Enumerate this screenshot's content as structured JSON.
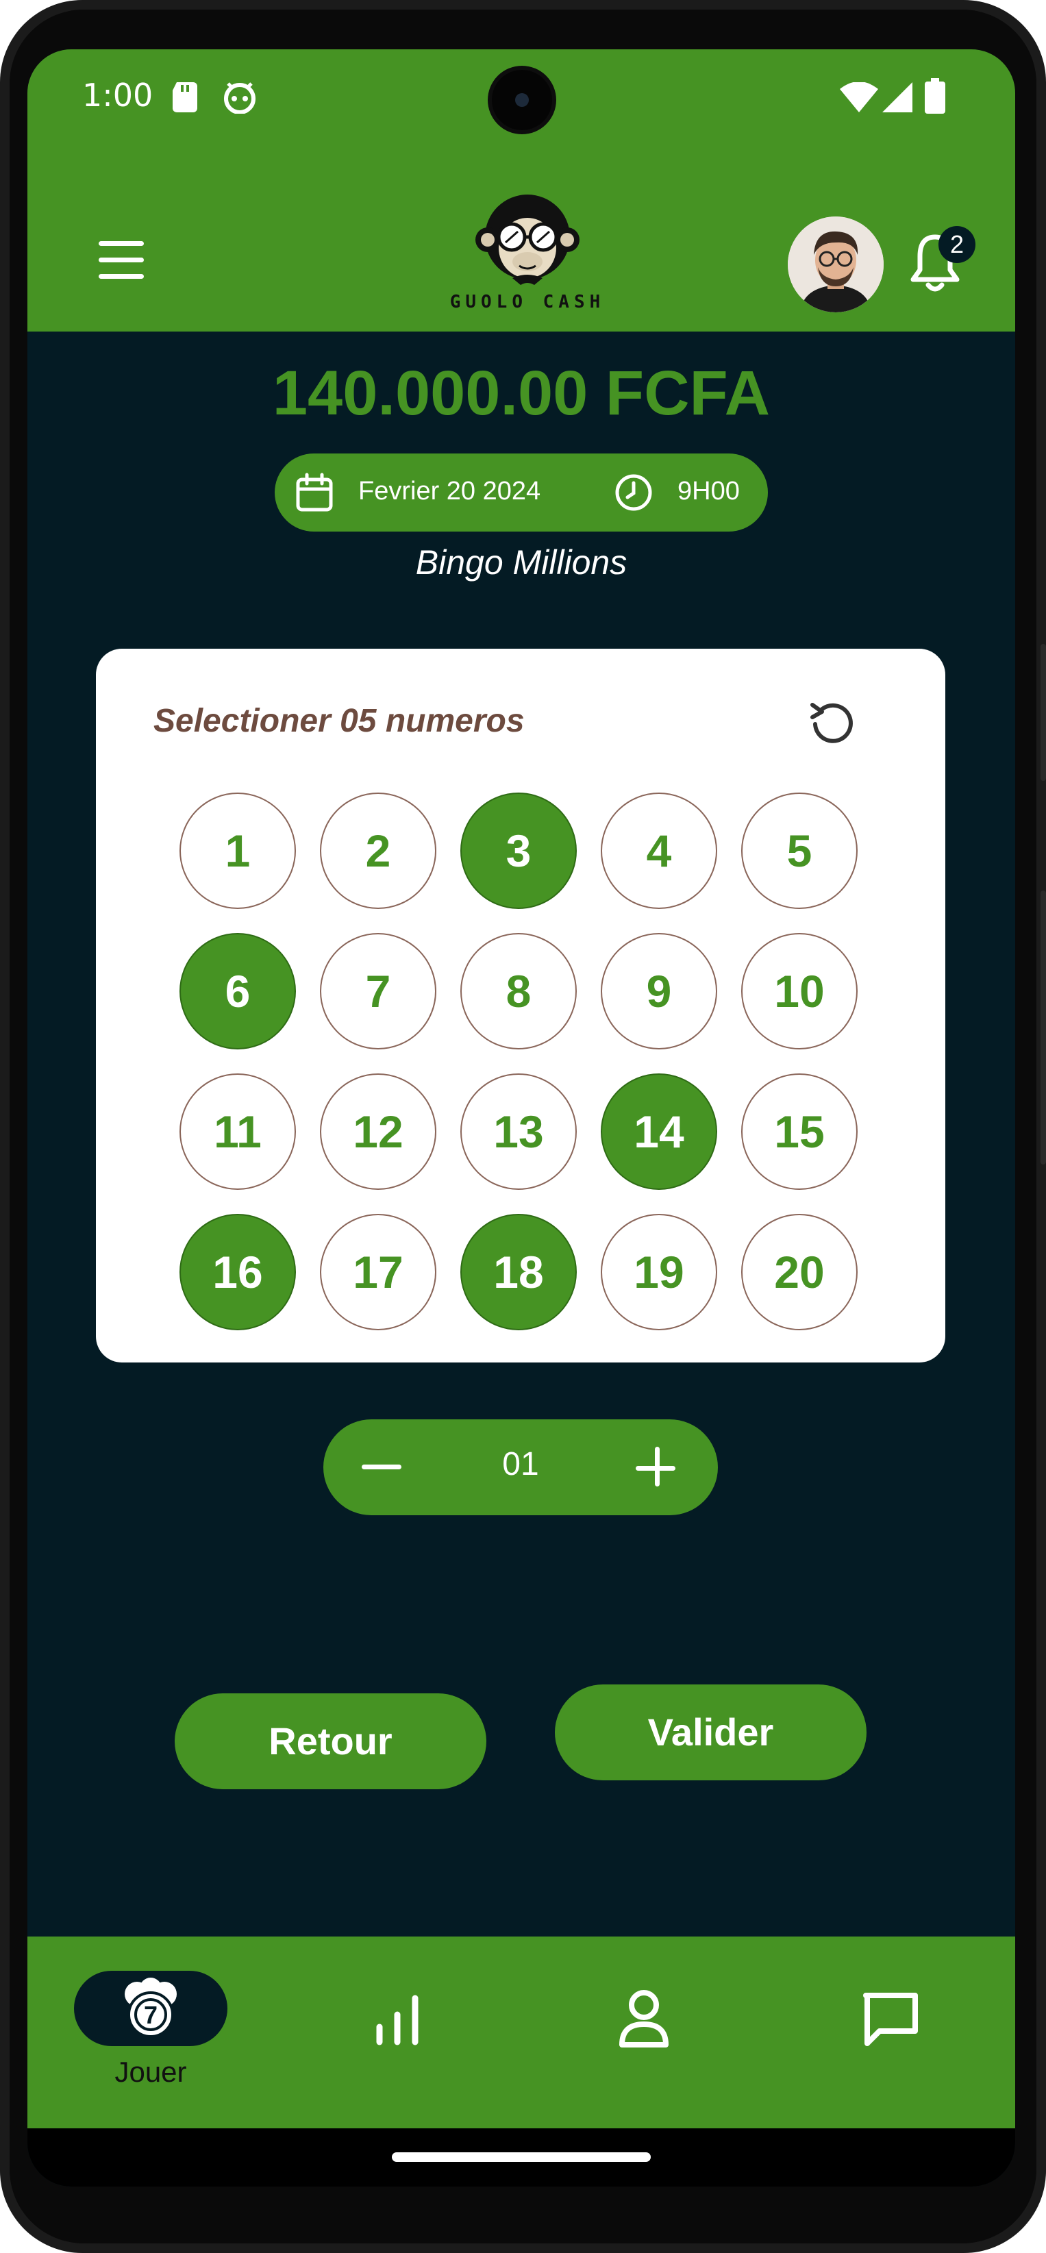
{
  "status_bar": {
    "time": "1:00",
    "icons": [
      "sd-card-icon",
      "android-icon",
      "wifi-icon",
      "signal-icon",
      "battery-icon"
    ]
  },
  "header": {
    "menu_icon": "hamburger-menu-icon",
    "logo_text": "GUOLO CASH",
    "avatar": "user-avatar",
    "notification_icon": "bell-icon",
    "notification_count": "2"
  },
  "prize": {
    "amount": "140.000.00 FCFA",
    "date": "Fevrier 20 2024",
    "time": "9H00",
    "game_name": "Bingo Millions"
  },
  "selection": {
    "title": "Selectioner 05 numeros",
    "reset_icon": "reset-icon",
    "numbers": [
      {
        "label": "1",
        "selected": false
      },
      {
        "label": "2",
        "selected": false
      },
      {
        "label": "3",
        "selected": true
      },
      {
        "label": "4",
        "selected": false
      },
      {
        "label": "5",
        "selected": false
      },
      {
        "label": "6",
        "selected": true
      },
      {
        "label": "7",
        "selected": false
      },
      {
        "label": "8",
        "selected": false
      },
      {
        "label": "9",
        "selected": false
      },
      {
        "label": "10",
        "selected": false
      },
      {
        "label": "11",
        "selected": false
      },
      {
        "label": "12",
        "selected": false
      },
      {
        "label": "13",
        "selected": false
      },
      {
        "label": "14",
        "selected": true
      },
      {
        "label": "15",
        "selected": false
      },
      {
        "label": "16",
        "selected": true
      },
      {
        "label": "17",
        "selected": false
      },
      {
        "label": "18",
        "selected": true
      },
      {
        "label": "19",
        "selected": false
      },
      {
        "label": "20",
        "selected": false
      }
    ]
  },
  "stepper": {
    "value": "01"
  },
  "actions": {
    "back_label": "Retour",
    "validate_label": "Valider"
  },
  "bottom_nav": {
    "items": [
      {
        "label": "Jouer",
        "icon": "lottery-balls-icon",
        "active": true
      },
      {
        "label": "",
        "icon": "stats-icon",
        "active": false
      },
      {
        "label": "",
        "icon": "profile-icon",
        "active": false
      },
      {
        "label": "",
        "icon": "chat-icon",
        "active": false
      }
    ]
  },
  "colors": {
    "brand_green": "#469323",
    "background": "#041b24",
    "title_brown": "#6d4b3f"
  }
}
